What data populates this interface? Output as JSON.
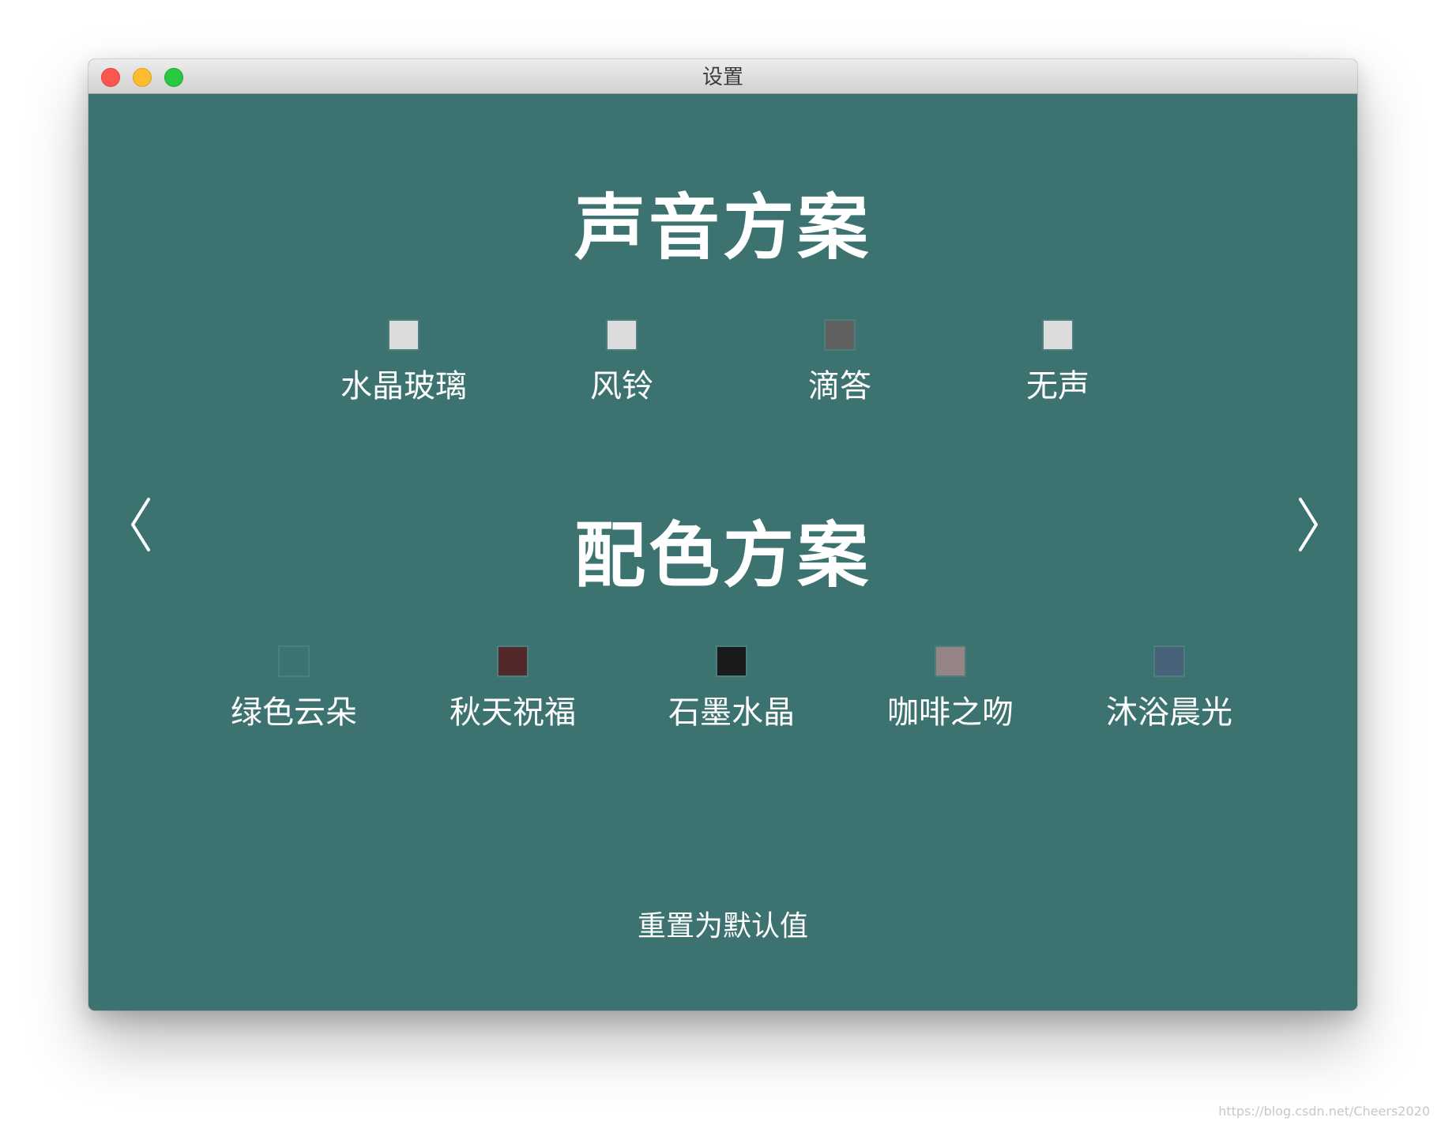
{
  "window": {
    "title": "设置"
  },
  "sound": {
    "heading": "声音方案",
    "options": [
      {
        "label": "水晶玻璃",
        "color": "#dcdcdc"
      },
      {
        "label": "风铃",
        "color": "#dcdcdc"
      },
      {
        "label": "滴答",
        "color": "#616161"
      },
      {
        "label": "无声",
        "color": "#dcdcdc"
      }
    ]
  },
  "theme": {
    "heading": "配色方案",
    "options": [
      {
        "label": "绿色云朵",
        "color": "#3c7371"
      },
      {
        "label": "秋天祝福",
        "color": "#53282b"
      },
      {
        "label": "石墨水晶",
        "color": "#1a1b1c"
      },
      {
        "label": "咖啡之吻",
        "color": "#958585"
      },
      {
        "label": "沐浴晨光",
        "color": "#48627a"
      }
    ]
  },
  "nav": {
    "prev_icon": "chevron-left-icon",
    "next_icon": "chevron-right-icon"
  },
  "footer": {
    "reset_label": "重置为默认值"
  },
  "watermark": "https://blog.csdn.net/Cheers2020",
  "colors": {
    "background": "#3c7371",
    "text": "#ffffff"
  }
}
